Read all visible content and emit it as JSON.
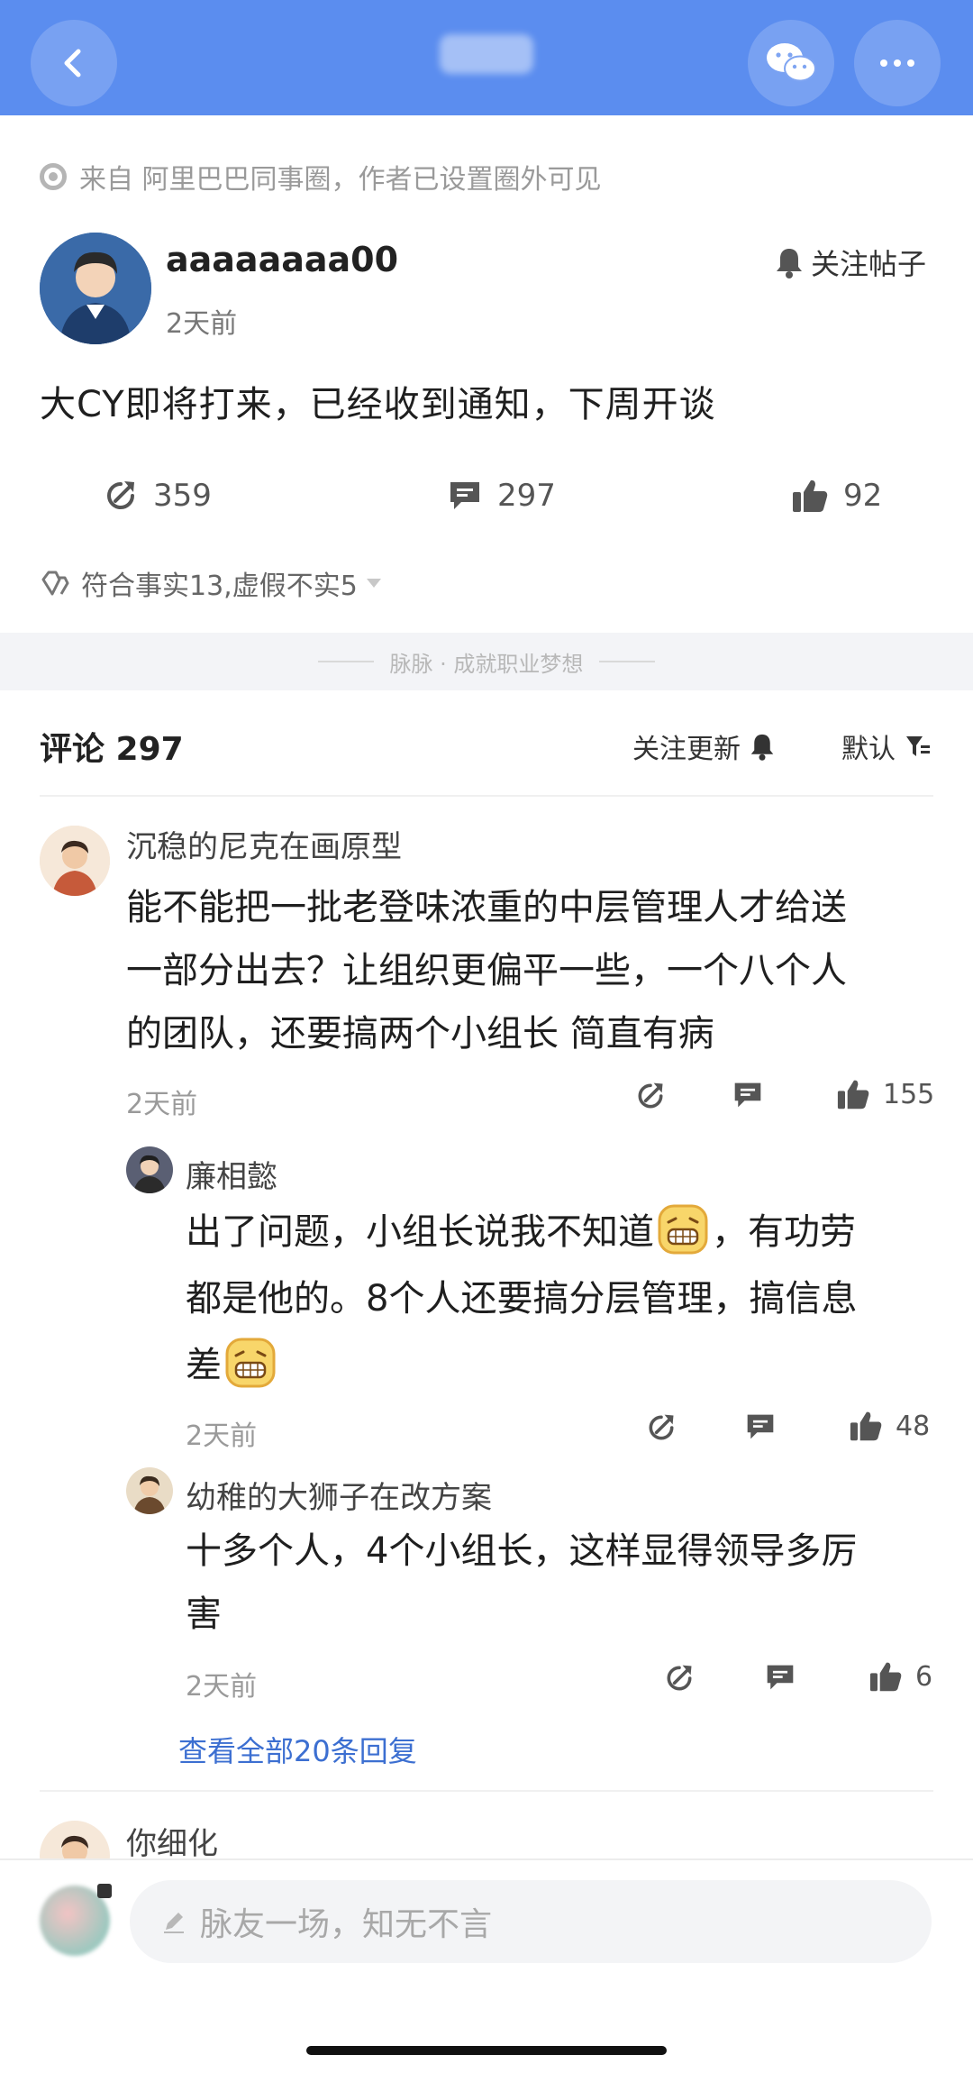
{
  "header": {
    "back_icon": "chevron-left-icon",
    "wechat_icon": "wechat-icon",
    "more_icon": "more-dots-icon",
    "accent_color": "#5b8def"
  },
  "post": {
    "source": "来自 阿里巴巴同事圈，作者已设置圈外可见",
    "author_name": "aaaaaaaa00",
    "time": "2天前",
    "follow_label": "关注帖子",
    "content": "大CY即将打来，已经收到通知，下周开谈",
    "share_count": "359",
    "comment_count": "297",
    "like_count": "92",
    "fact_check": "符合事实13,虚假不实5"
  },
  "divider_text": "脉脉 · 成就职业梦想",
  "comments_header": {
    "title": "评论 297",
    "follow_updates": "关注更新",
    "sort": "默认"
  },
  "comments": [
    {
      "name": "沉稳的尼克在画原型",
      "lines": [
        "能不能把一批老登味浓重的中层管理人才给送",
        "一部分出去？让组织更偏平一些，一个八个人",
        "的团队，还要搞两个小组长 简直有病"
      ],
      "time": "2天前",
      "likes": "155"
    }
  ],
  "replies": [
    {
      "name": "廉相懿",
      "line1_a": "出了问题，小组长说我不知道",
      "line1_b": "，有功劳",
      "line2": "都是他的。8个人还要搞分层管理，搞信息",
      "line3": "差",
      "time": "2天前",
      "likes": "48"
    },
    {
      "name": "幼稚的大狮子在改方案",
      "line1": "十多个人，4个小组长，这样显得领导多厉",
      "line2": "害",
      "time": "2天前",
      "likes": "6"
    }
  ],
  "view_all_replies": "查看全部20条回复",
  "next_comment_name": "你细化",
  "input": {
    "placeholder": "脉友一场，知无不言"
  }
}
